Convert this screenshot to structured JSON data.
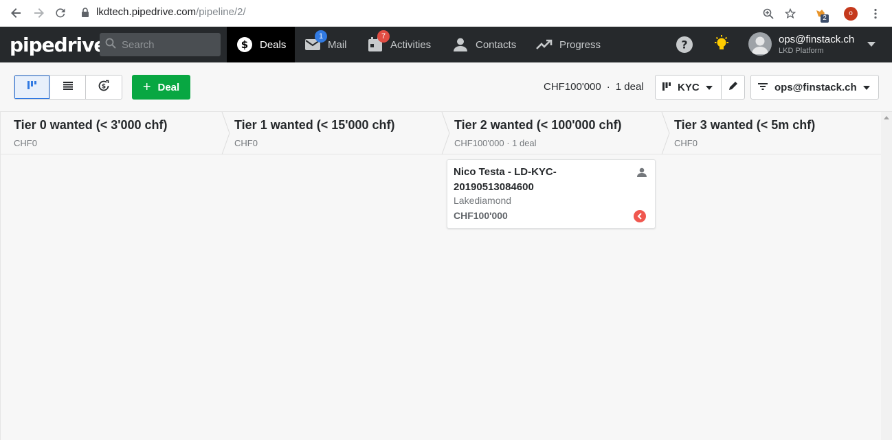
{
  "browser": {
    "url_host": "lkdtech.pipedrive.com",
    "url_path": "/pipeline/2/",
    "extension_badge": "2",
    "profile_initial": "o"
  },
  "app": {
    "logo": "pipedrive",
    "search_placeholder": "Search",
    "nav": [
      {
        "label": "Deals",
        "active": true
      },
      {
        "label": "Mail",
        "badge": "1"
      },
      {
        "label": "Activities",
        "badge": "7"
      },
      {
        "label": "Contacts"
      },
      {
        "label": "Progress"
      }
    ],
    "user": {
      "name": "ops@finstack.ch",
      "company": "LKD Platform"
    }
  },
  "toolbar": {
    "add_deal_label": "Deal",
    "summary_value": "CHF100'000",
    "summary_sep": "·",
    "summary_count": "1 deal",
    "pipeline": "KYC",
    "filter": "ops@finstack.ch"
  },
  "stages": [
    {
      "title": "Tier 0 wanted (< 3'000 chf)",
      "sub": "CHF0"
    },
    {
      "title": "Tier 1 wanted (< 15'000 chf)",
      "sub": "CHF0"
    },
    {
      "title": "Tier 2 wanted (< 100'000 chf)",
      "sub": "CHF100'000 · 1 deal"
    },
    {
      "title": "Tier 3 wanted (< 5m chf)",
      "sub": "CHF0"
    }
  ],
  "deal": {
    "title": "Nico Testa - LD-KYC-20190513084600",
    "organization": "Lakediamond",
    "value": "CHF100'000"
  },
  "colors": {
    "nav_bg": "#26292c",
    "primary_green": "#08a742",
    "badge_blue": "#317ae2",
    "badge_red": "#e14d43",
    "bulb_yellow": "#ffcc00",
    "status_red": "#f0574f"
  }
}
